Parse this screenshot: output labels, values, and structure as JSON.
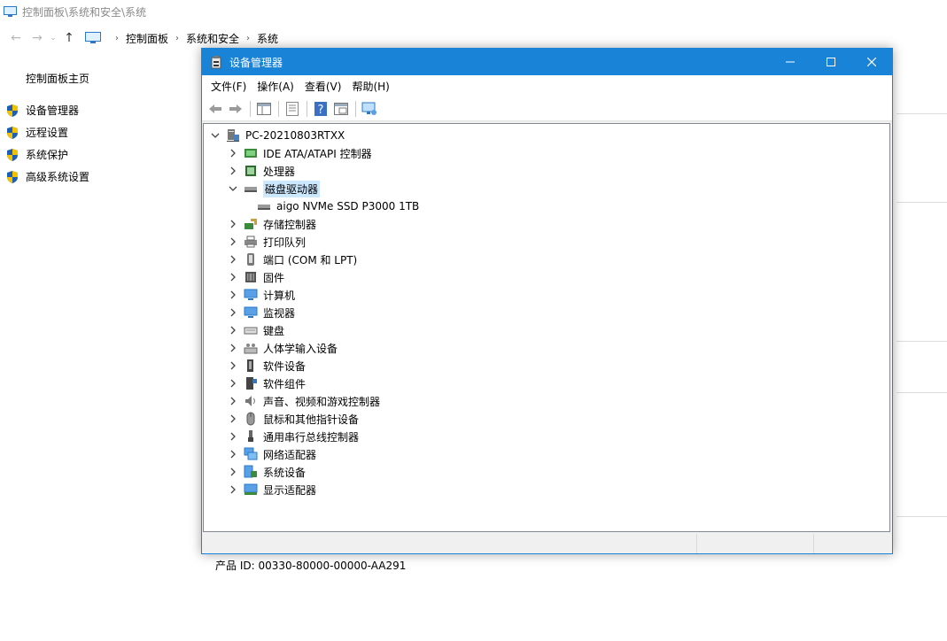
{
  "background": {
    "title_path": "控制面板\\系统和安全\\系统",
    "breadcrumbs": [
      "控制面板",
      "系统和安全",
      "系统"
    ],
    "left_nav": {
      "home": "控制面板主页",
      "tasks": [
        "设备管理器",
        "远程设置",
        "系统保护",
        "高级系统设置"
      ]
    },
    "product_id": "产品 ID: 00330-80000-00000-AA291"
  },
  "device_manager": {
    "title": "设备管理器",
    "menu": [
      "文件(F)",
      "操作(A)",
      "查看(V)",
      "帮助(H)"
    ],
    "toolbar_icons": [
      "back-icon",
      "forward-icon",
      "show-hide-tree-icon",
      "properties-icon",
      "help-icon",
      "view-icon",
      "scan-hardware-icon"
    ],
    "tree": {
      "root": "PC-20210803RTXX",
      "categories": [
        {
          "label": "IDE ATA/ATAPI 控制器",
          "icon": "ide-controller-icon",
          "expanded": false
        },
        {
          "label": "处理器",
          "icon": "processor-icon",
          "expanded": false
        },
        {
          "label": "磁盘驱动器",
          "icon": "disk-drive-icon",
          "expanded": true,
          "selected": true,
          "children": [
            {
              "label": "aigo NVMe SSD P3000 1TB",
              "icon": "disk-icon"
            }
          ]
        },
        {
          "label": "存储控制器",
          "icon": "storage-controller-icon",
          "expanded": false
        },
        {
          "label": "打印队列",
          "icon": "printer-icon",
          "expanded": false
        },
        {
          "label": "端口 (COM 和 LPT)",
          "icon": "port-icon",
          "expanded": false
        },
        {
          "label": "固件",
          "icon": "firmware-icon",
          "expanded": false
        },
        {
          "label": "计算机",
          "icon": "computer-icon",
          "expanded": false
        },
        {
          "label": "监视器",
          "icon": "monitor-icon",
          "expanded": false
        },
        {
          "label": "键盘",
          "icon": "keyboard-icon",
          "expanded": false
        },
        {
          "label": "人体学输入设备",
          "icon": "hid-icon",
          "expanded": false
        },
        {
          "label": "软件设备",
          "icon": "software-device-icon",
          "expanded": false
        },
        {
          "label": "软件组件",
          "icon": "software-component-icon",
          "expanded": false
        },
        {
          "label": "声音、视频和游戏控制器",
          "icon": "speaker-icon",
          "expanded": false
        },
        {
          "label": "鼠标和其他指针设备",
          "icon": "mouse-icon",
          "expanded": false
        },
        {
          "label": "通用串行总线控制器",
          "icon": "usb-icon",
          "expanded": false
        },
        {
          "label": "网络适配器",
          "icon": "network-icon",
          "expanded": false
        },
        {
          "label": "系统设备",
          "icon": "system-device-icon",
          "expanded": false
        },
        {
          "label": "显示适配器",
          "icon": "display-adapter-icon",
          "expanded": false
        }
      ]
    }
  },
  "colors": {
    "titlebar": "#1883d7",
    "selection": "#cce8ff",
    "icon_blue": "#2b78c6",
    "shield_blue": "#1e5fb4",
    "shield_yellow": "#f2c100"
  }
}
